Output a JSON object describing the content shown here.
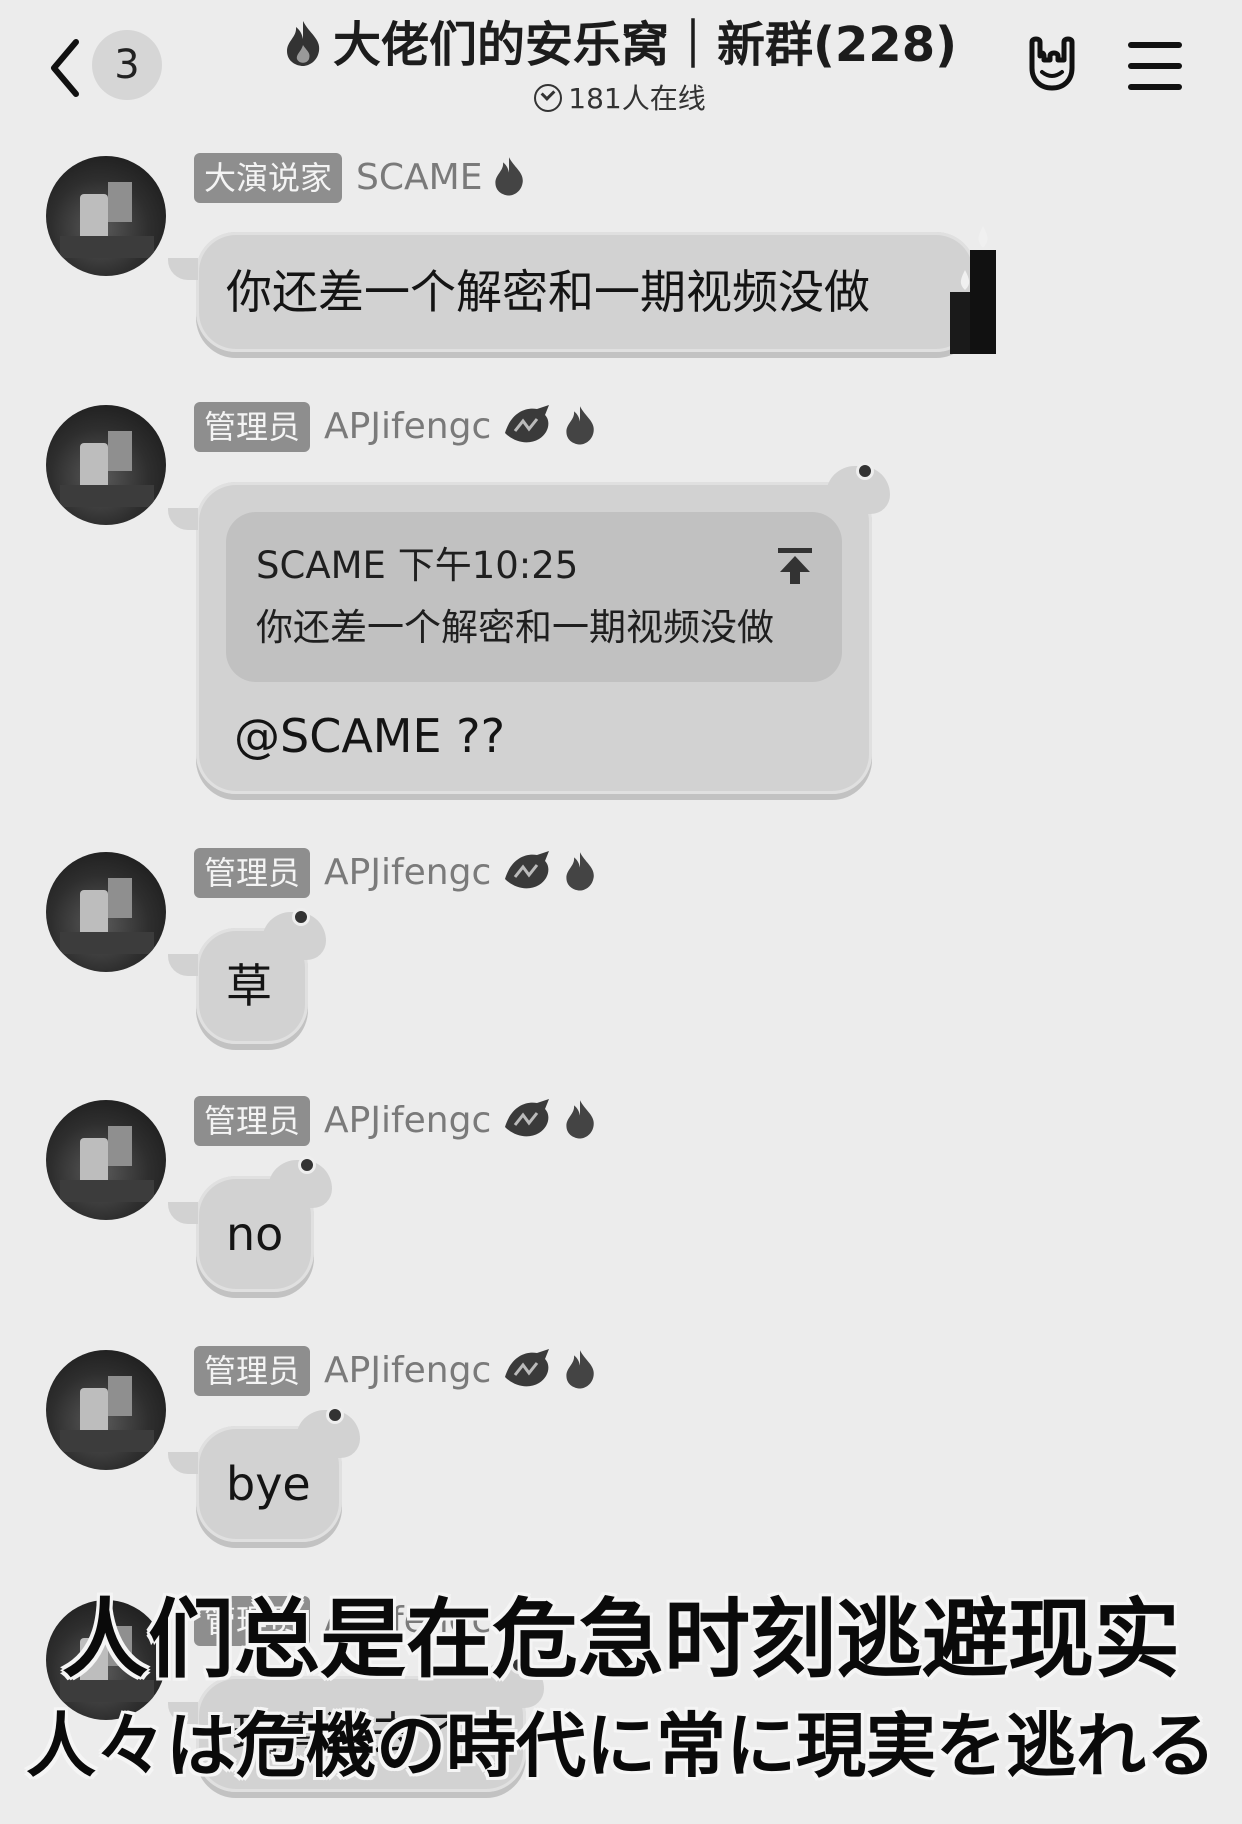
{
  "header": {
    "back_badge": "3",
    "title": "大佬们的安乐窝｜新群(228)",
    "online": "181人在线",
    "icons": [
      "chevron-left-icon",
      "flame-icon",
      "rock-hand-icon",
      "menu-icon"
    ]
  },
  "messages": [
    {
      "tag": "大演说家",
      "name": "SCAME",
      "text": "你还差一个解密和一期视频没做"
    },
    {
      "tag": "管理员",
      "name": "APJifengc",
      "quote_header": "SCAME 下午10:25",
      "quote_text": "你还差一个解密和一期视频没做",
      "text": "@SCAME ??"
    },
    {
      "tag": "管理员",
      "name": "APJifengc",
      "text": "草"
    },
    {
      "tag": "管理员",
      "name": "APJifengc",
      "text": "no"
    },
    {
      "tag": "管理员",
      "name": "APJifengc",
      "text": "bye"
    },
    {
      "tag": "管理员",
      "name": "APJifengc",
      "text": "玩真游去了"
    }
  ],
  "subtitles": {
    "chinese": "人们总是在危急时刻逃避现实",
    "japanese": "人々は危機の時代に常に現実を逃れる"
  },
  "colors": {
    "background": "#ececec",
    "bubble": "#d2d2d2",
    "tag": "#8e8e8e"
  }
}
